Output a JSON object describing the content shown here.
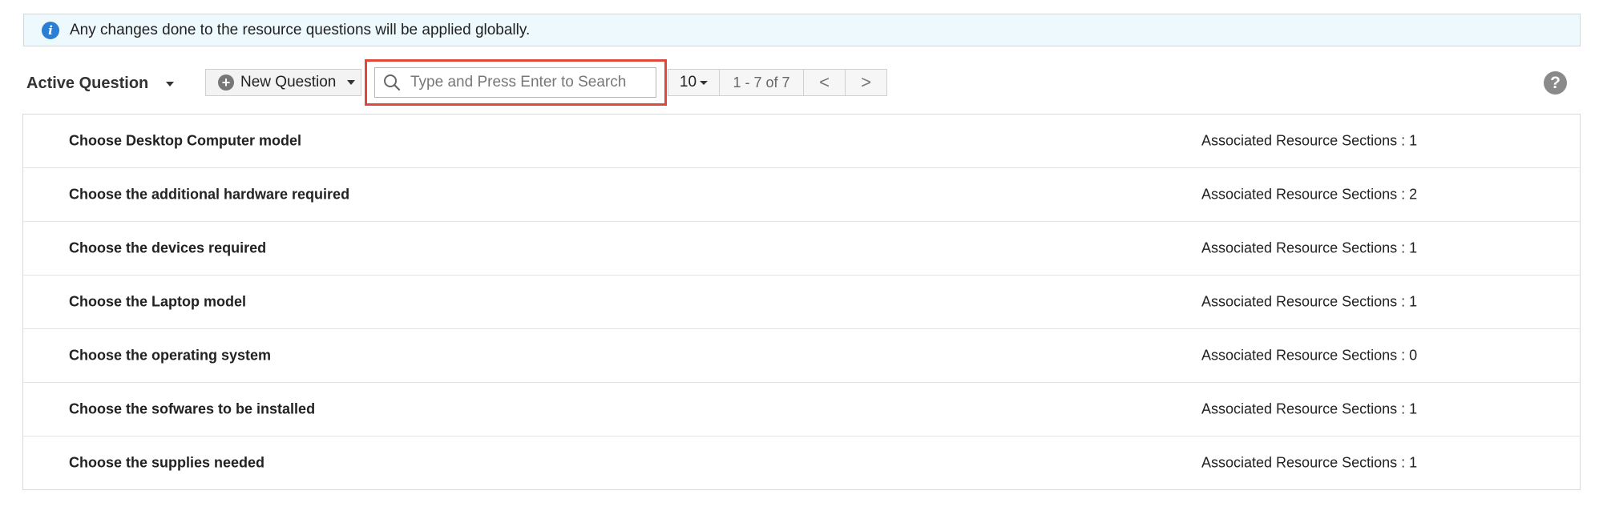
{
  "info": {
    "message": "Any changes done to the resource questions will be applied globally.",
    "icon": "info-icon"
  },
  "toolbar": {
    "view_label": "Active Question",
    "new_button_label": "New Question",
    "search_placeholder": "Type and Press Enter to Search",
    "page_size": "10",
    "page_range": "1 - 7 of 7",
    "prev_label": "<",
    "next_label": ">",
    "help_label": "?"
  },
  "questions": [
    {
      "title": "Choose Desktop Computer model",
      "associated": "Associated Resource Sections : 1"
    },
    {
      "title": "Choose the additional hardware required",
      "associated": "Associated Resource Sections : 2"
    },
    {
      "title": "Choose the devices required",
      "associated": "Associated Resource Sections : 1"
    },
    {
      "title": "Choose the Laptop model",
      "associated": "Associated Resource Sections : 1"
    },
    {
      "title": "Choose the operating system",
      "associated": "Associated Resource Sections : 0"
    },
    {
      "title": "Choose the sofwares to be installed",
      "associated": "Associated Resource Sections : 1"
    },
    {
      "title": "Choose the supplies needed",
      "associated": "Associated Resource Sections : 1"
    }
  ],
  "colors": {
    "info_background": "#eef9fd",
    "info_icon": "#2a7fd4",
    "highlight_border": "#e0483b"
  }
}
